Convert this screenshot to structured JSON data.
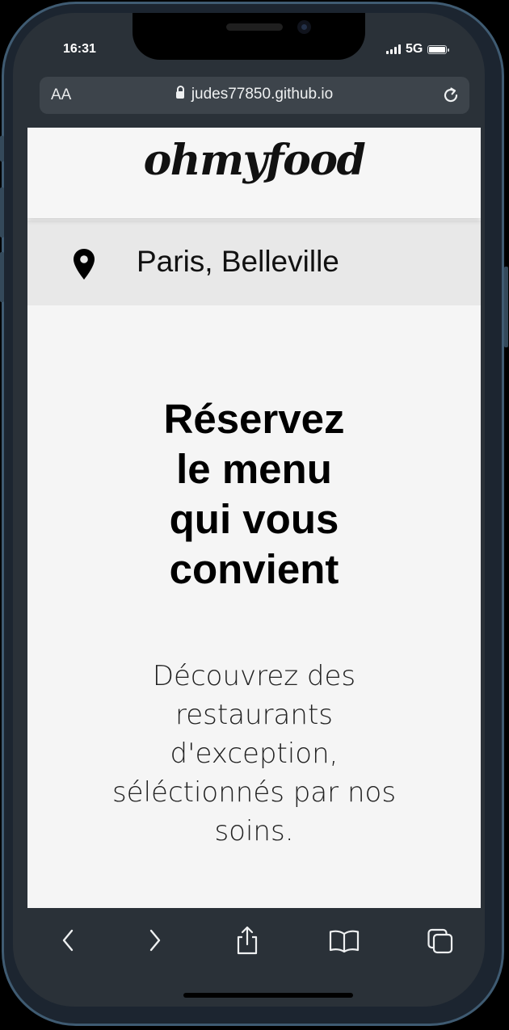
{
  "status_bar": {
    "time": "16:31",
    "network": "5G"
  },
  "browser": {
    "text_size_label": "AA",
    "url": "judes77850.github.io",
    "icons": {
      "lock": "lock-icon",
      "reload": "reload-icon",
      "back": "chevron-left-icon",
      "forward": "chevron-right-icon",
      "share": "share-icon",
      "bookmarks": "book-icon",
      "tabs": "tabs-icon"
    }
  },
  "site": {
    "logo": "ohmyfood",
    "location": {
      "icon": "map-pin-icon",
      "label": "Paris, Belleville"
    },
    "hero": {
      "title_lines": [
        "Réservez",
        "le menu",
        "qui vous",
        "convient"
      ],
      "subtitle_lines": [
        "Découvrez des",
        "restaurants",
        "d'exception,",
        "séléctionnés par nos",
        "soins."
      ]
    }
  },
  "colors": {
    "page_background": "#f5f5f5",
    "location_bar": "#e8e8e8",
    "cta_gradient_start": "#ee6ed6",
    "cta_gradient_end": "#b05fdd",
    "toolbar": "#2a3138"
  }
}
